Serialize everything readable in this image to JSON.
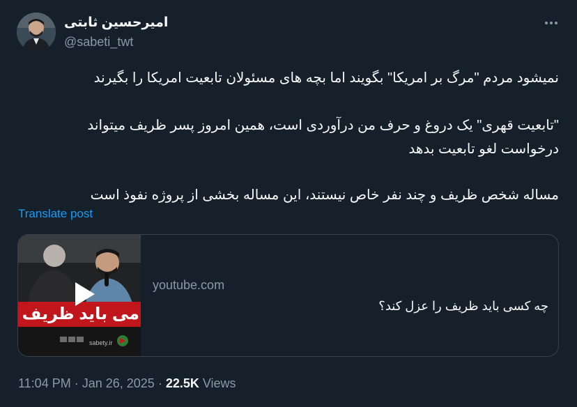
{
  "header": {
    "display_name": "امیرحسین ثابتی",
    "handle": "@sabeti_twt"
  },
  "icons": {
    "more": "more-horizontal-icon",
    "play": "play-icon"
  },
  "tweet": {
    "paragraph1": "نمیشود مردم \"مرگ بر امریکا\" بگویند اما بچه های مسئولان تابعیت امریکا را بگیرند",
    "paragraph2_line1": "\"تابعیت قهری\" یک دروغ و حرف من درآوردی است، همین امروز پسر ظریف میتواند",
    "paragraph2_line2": "درخواست لغو تابعیت بدهد",
    "paragraph3": "مساله شخص ظریف و چند نفر خاص نیستند، این مساله بخشی از پروژه نفوذ است",
    "translate_label": "Translate post"
  },
  "card": {
    "domain": "youtube.com",
    "title": "چه کسی باید ظریف را عزل کند؟",
    "thumbnail_banner": "می باید ظریف را عزل",
    "thumbnail_watermark": "sabety.ir"
  },
  "meta": {
    "time": "11:04 PM",
    "date": "Jan 26, 2025",
    "separator": " · ",
    "views_count": "22.5K",
    "views_label": " Views"
  },
  "colors": {
    "background": "#15202b",
    "text_primary": "#f7f9f9",
    "text_secondary": "#8b98a5",
    "link": "#1d9bf0",
    "border": "#38444d",
    "banner_red": "#c0161c"
  }
}
